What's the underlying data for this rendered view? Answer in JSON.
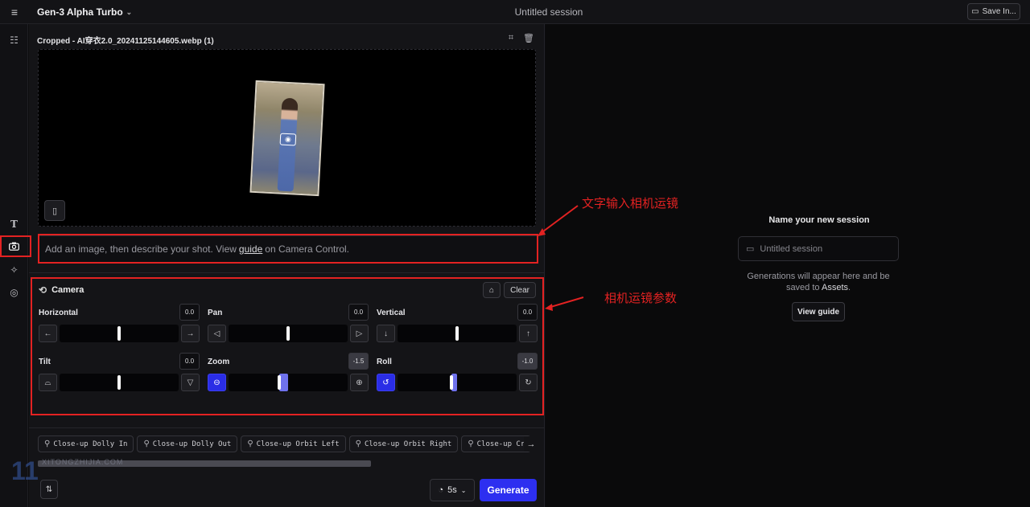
{
  "topbar": {
    "model_name": "Gen-3 Alpha Turbo",
    "session_title": "Untitled session",
    "save_label": "Save In..."
  },
  "sidebar": {
    "items": [
      {
        "name": "grid-icon"
      },
      {
        "name": "text-icon"
      },
      {
        "name": "camera-icon"
      },
      {
        "name": "magic-icon"
      },
      {
        "name": "film-icon"
      }
    ]
  },
  "input": {
    "file_name": "Cropped - AI穿衣2.0_20241125144605.webp (1)",
    "prompt_placeholder": "Add an image, then describe your shot. View",
    "prompt_link": "guide",
    "prompt_suffix": "on Camera Control."
  },
  "camera": {
    "title": "Camera",
    "clear_label": "Clear",
    "params": [
      {
        "label": "Horizontal",
        "value": "0.0",
        "level": 0.0,
        "min": -10,
        "max": 10,
        "left_icon": "←",
        "right_icon": "→",
        "active": false
      },
      {
        "label": "Pan",
        "value": "0.0",
        "level": 0.0,
        "min": -10,
        "max": 10,
        "left_icon": "◁",
        "right_icon": "▷",
        "active": false
      },
      {
        "label": "Vertical",
        "value": "0.0",
        "level": 0.0,
        "min": -10,
        "max": 10,
        "left_icon": "↓",
        "right_icon": "↑",
        "active": false
      },
      {
        "label": "Tilt",
        "value": "0.0",
        "level": 0.0,
        "min": -10,
        "max": 10,
        "left_icon": "⌓",
        "right_icon": "▽",
        "active": false
      },
      {
        "label": "Zoom",
        "value": "-1.5",
        "level": -1.5,
        "min": -10,
        "max": 10,
        "left_icon": "⊖",
        "right_icon": "⊕",
        "active": true
      },
      {
        "label": "Roll",
        "value": "-1.0",
        "level": -1.0,
        "min": -10,
        "max": 10,
        "left_icon": "↺",
        "right_icon": "↻",
        "active": true
      }
    ]
  },
  "presets": [
    "Close-up Dolly In",
    "Close-up Dolly Out",
    "Close-up Orbit Left",
    "Close-up Orbit Right",
    "Close-up Cr"
  ],
  "footer": {
    "duration": "5s",
    "generate_label": "Generate"
  },
  "right": {
    "title": "Name your new session",
    "session_placeholder": "Untitled session",
    "note_prefix": "Generations will appear here and be saved to",
    "note_link": "Assets",
    "note_suffix": ".",
    "guide_label": "View guide"
  },
  "annotations": {
    "text_camera": "文字输入相机运镜",
    "camera_params": "相机运镜参数",
    "accent_color": "#e32222"
  },
  "watermark": {
    "number": "11",
    "text": "XITONGZHIJIA.COM"
  }
}
